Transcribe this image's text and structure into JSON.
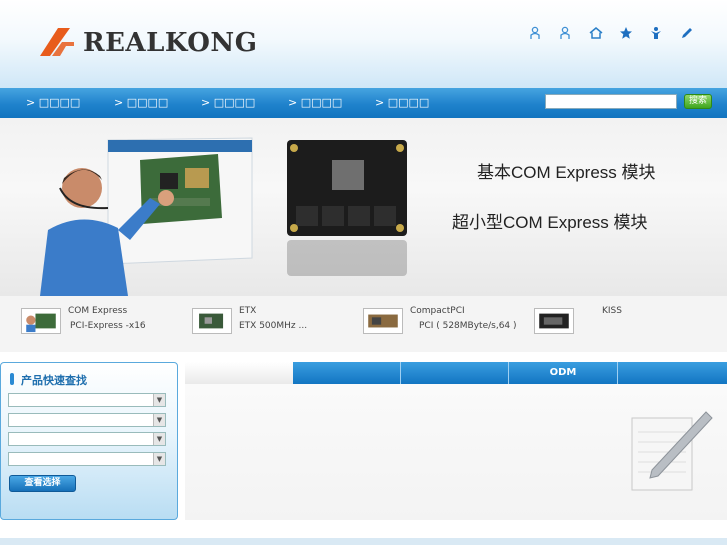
{
  "brand": {
    "name": "REALKONG",
    "accent": "#e85c1c"
  },
  "header_icons": [
    "user-icon",
    "user-icon",
    "home-icon",
    "star-icon",
    "person-icon",
    "pencil-icon"
  ],
  "nav": {
    "items": [
      "> □□□□",
      "> □□□□",
      "> □□□□",
      "> □□□□",
      "> □□□□"
    ],
    "search_placeholder": "",
    "search_button": "搜索"
  },
  "banner": {
    "title1": "基本COM  Express 模块",
    "title2": "超小型COM Express 模块"
  },
  "products": [
    {
      "name": "COM Express",
      "desc": "PCI-Express   -x16"
    },
    {
      "name": "ETX",
      "desc": "ETX      500MHz      ..."
    },
    {
      "name": "CompactPCI",
      "desc": "PCI  (  528MByte/s,64  )"
    },
    {
      "name": "KISS",
      "desc": ""
    }
  ],
  "quick_search": {
    "title": "产品快速查找",
    "selects": [
      "",
      "",
      "",
      ""
    ],
    "button": "查看选择"
  },
  "tabs": [
    "",
    "",
    "",
    "ODM",
    ""
  ]
}
